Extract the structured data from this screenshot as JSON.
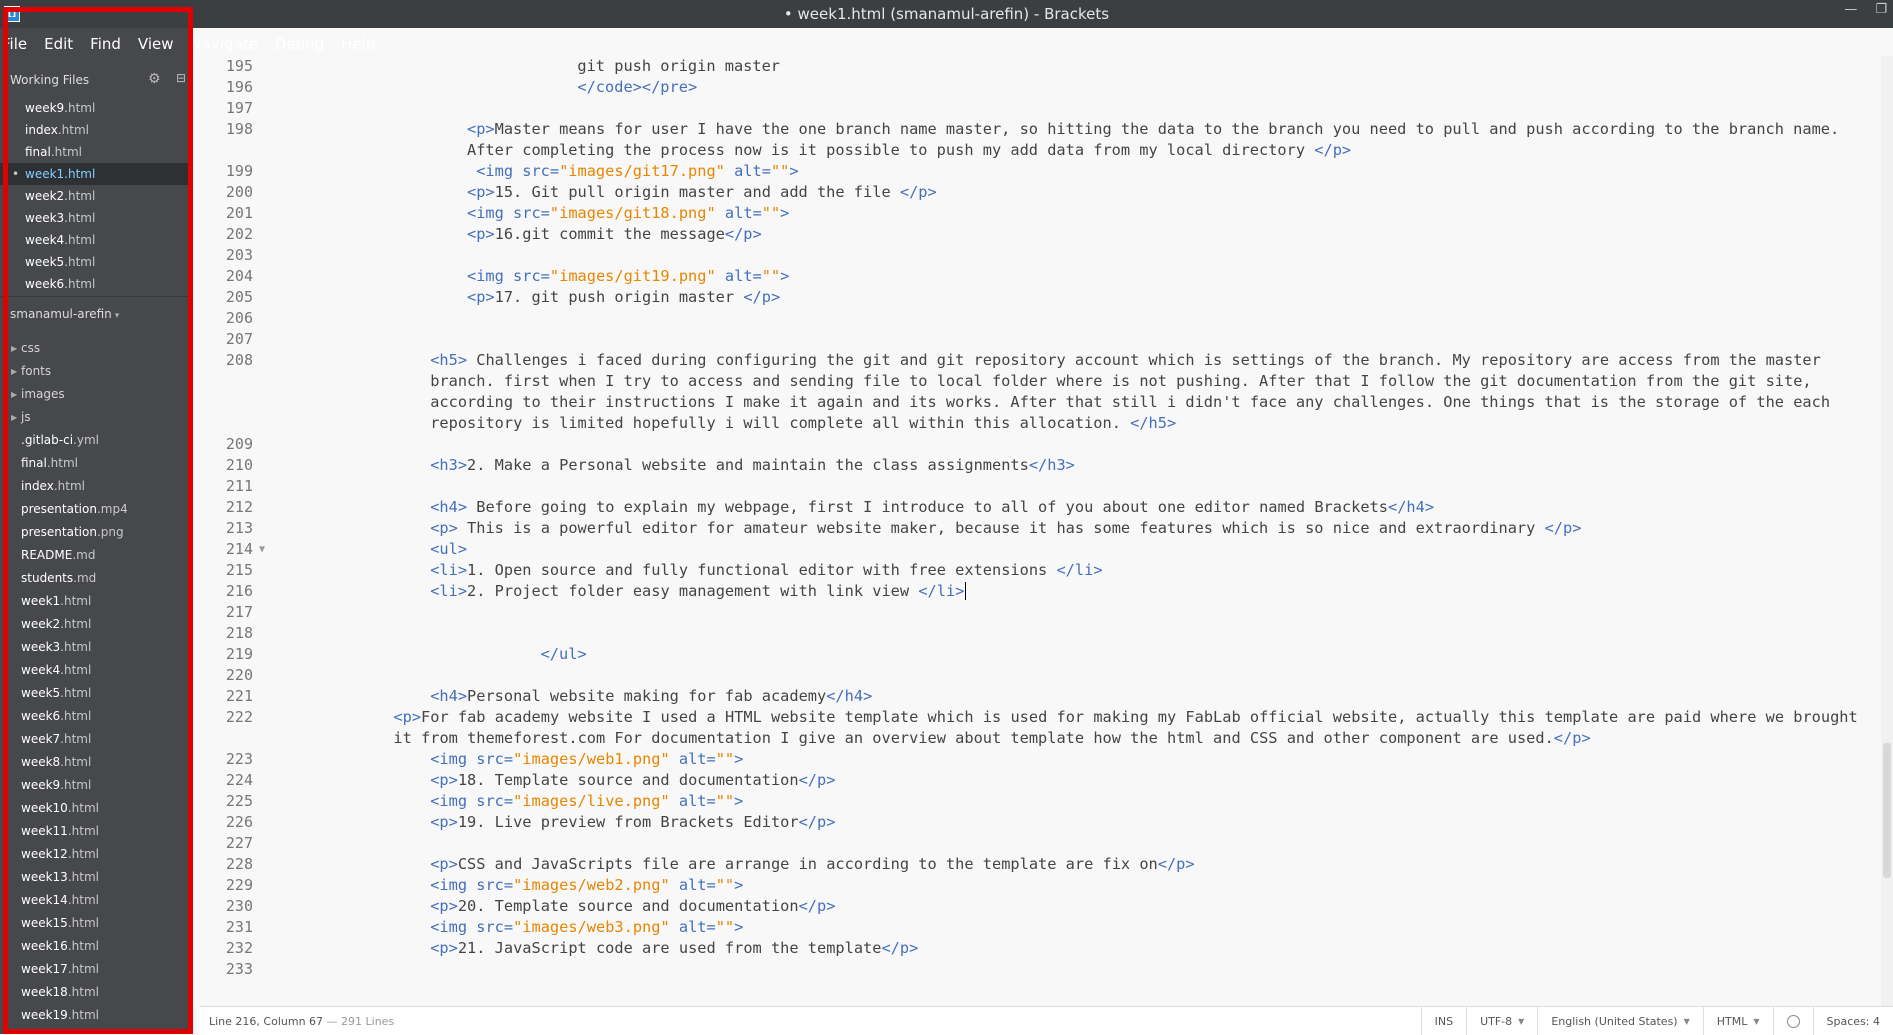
{
  "window": {
    "title": "• week1.html (smanamul-arefin) - Brackets",
    "icon": "brackets-app-icon",
    "controls": [
      "—",
      "❐"
    ]
  },
  "menu": [
    "File",
    "Edit",
    "Find",
    "View",
    "Navigate",
    "Debug",
    "Help"
  ],
  "sidebar": {
    "working_files_label": "Working Files",
    "working_files": [
      {
        "name": "week9",
        "ext": ".html",
        "active": false
      },
      {
        "name": "index",
        "ext": ".html",
        "active": false
      },
      {
        "name": "final",
        "ext": ".html",
        "active": false
      },
      {
        "name": "week1",
        "ext": ".html",
        "active": true
      },
      {
        "name": "week2",
        "ext": ".html",
        "active": false
      },
      {
        "name": "week3",
        "ext": ".html",
        "active": false
      },
      {
        "name": "week4",
        "ext": ".html",
        "active": false
      },
      {
        "name": "week5",
        "ext": ".html",
        "active": false
      },
      {
        "name": "week6",
        "ext": ".html",
        "active": false
      }
    ],
    "project_name": "smanamul-arefin",
    "tree": [
      {
        "name": "css",
        "ext": "",
        "folder": true
      },
      {
        "name": "fonts",
        "ext": "",
        "folder": true
      },
      {
        "name": "images",
        "ext": "",
        "folder": true
      },
      {
        "name": "js",
        "ext": "",
        "folder": true
      },
      {
        "name": ".gitlab-ci",
        "ext": ".yml",
        "folder": false
      },
      {
        "name": "final",
        "ext": ".html",
        "folder": false
      },
      {
        "name": "index",
        "ext": ".html",
        "folder": false
      },
      {
        "name": "presentation",
        "ext": ".mp4",
        "folder": false
      },
      {
        "name": "presentation",
        "ext": ".png",
        "folder": false
      },
      {
        "name": "README",
        "ext": ".md",
        "folder": false
      },
      {
        "name": "students",
        "ext": ".md",
        "folder": false
      },
      {
        "name": "week1",
        "ext": ".html",
        "folder": false
      },
      {
        "name": "week2",
        "ext": ".html",
        "folder": false
      },
      {
        "name": "week3",
        "ext": ".html",
        "folder": false
      },
      {
        "name": "week4",
        "ext": ".html",
        "folder": false
      },
      {
        "name": "week5",
        "ext": ".html",
        "folder": false
      },
      {
        "name": "week6",
        "ext": ".html",
        "folder": false
      },
      {
        "name": "week7",
        "ext": ".html",
        "folder": false
      },
      {
        "name": "week8",
        "ext": ".html",
        "folder": false
      },
      {
        "name": "week9",
        "ext": ".html",
        "folder": false
      },
      {
        "name": "week10",
        "ext": ".html",
        "folder": false
      },
      {
        "name": "week11",
        "ext": ".html",
        "folder": false
      },
      {
        "name": "week12",
        "ext": ".html",
        "folder": false
      },
      {
        "name": "week13",
        "ext": ".html",
        "folder": false
      },
      {
        "name": "week14",
        "ext": ".html",
        "folder": false
      },
      {
        "name": "week15",
        "ext": ".html",
        "folder": false
      },
      {
        "name": "week16",
        "ext": ".html",
        "folder": false
      },
      {
        "name": "week17",
        "ext": ".html",
        "folder": false
      },
      {
        "name": "week18",
        "ext": ".html",
        "folder": false
      },
      {
        "name": "week19",
        "ext": ".html",
        "folder": false
      }
    ]
  },
  "editor": {
    "lines": [
      {
        "n": "195",
        "indent": 32,
        "rows": 1,
        "text": "git push origin master"
      },
      {
        "n": "196",
        "indent": 32,
        "rows": 1,
        "text": "</code></pre>"
      },
      {
        "n": "197",
        "indent": 0,
        "rows": 1,
        "text": ""
      },
      {
        "n": "198",
        "indent": 20,
        "rows": 2,
        "text": "<p>Master means for user I have the one branch name master, so hitting the data to the branch you need to pull and push according to the branch name. After completing the process now is it possible to push my add data from my local directory </p>"
      },
      {
        "n": "199",
        "indent": 21,
        "rows": 1,
        "text": "<img src=\"images/git17.png\" alt=\"\">"
      },
      {
        "n": "200",
        "indent": 20,
        "rows": 1,
        "text": "<p>15. Git pull origin master and add the file </p>"
      },
      {
        "n": "201",
        "indent": 20,
        "rows": 1,
        "text": "<img src=\"images/git18.png\" alt=\"\">"
      },
      {
        "n": "202",
        "indent": 20,
        "rows": 1,
        "text": "<p>16.git commit the message</p>"
      },
      {
        "n": "203",
        "indent": 0,
        "rows": 1,
        "text": ""
      },
      {
        "n": "204",
        "indent": 20,
        "rows": 1,
        "text": "<img src=\"images/git19.png\" alt=\"\">"
      },
      {
        "n": "205",
        "indent": 20,
        "rows": 1,
        "text": "<p>17. git push origin master </p>"
      },
      {
        "n": "206",
        "indent": 0,
        "rows": 1,
        "text": ""
      },
      {
        "n": "207",
        "indent": 0,
        "rows": 1,
        "text": ""
      },
      {
        "n": "208",
        "indent": 16,
        "rows": 4,
        "text": "<h5> Challenges i faced during configuring the git and git repository account which is settings of the branch. My repository are access from the master branch. first when I try to access and sending file to local folder where is not pushing. After that I follow the git documentation from the git site, according to their instructions I make it again and its works. After that still i didn't face any challenges. One things that is the storage of the each repository is limited hopefully i will complete all within this allocation. </h5>"
      },
      {
        "n": "209",
        "indent": 0,
        "rows": 1,
        "text": ""
      },
      {
        "n": "210",
        "indent": 16,
        "rows": 1,
        "text": "<h3>2. Make a Personal website and maintain the class assignments</h3>"
      },
      {
        "n": "211",
        "indent": 0,
        "rows": 1,
        "text": ""
      },
      {
        "n": "212",
        "indent": 16,
        "rows": 1,
        "text": "<h4> Before going to explain my webpage, first I introduce to all of you about one editor named Brackets</h4>"
      },
      {
        "n": "213",
        "indent": 16,
        "rows": 1,
        "text": "<p> This is a powerful editor for amateur website maker, because it has some features which is so nice and extraordinary </p>"
      },
      {
        "n": "214",
        "indent": 16,
        "rows": 1,
        "text": "<ul>",
        "fold": true
      },
      {
        "n": "215",
        "indent": 16,
        "rows": 1,
        "text": "<li>1. Open source and fully functional editor with free extensions </li>"
      },
      {
        "n": "216",
        "indent": 16,
        "rows": 1,
        "text": "<li>2. Project folder easy management with link view </li>",
        "cursor": true
      },
      {
        "n": "217",
        "indent": 0,
        "rows": 1,
        "text": ""
      },
      {
        "n": "218",
        "indent": 0,
        "rows": 1,
        "text": ""
      },
      {
        "n": "219",
        "indent": 28,
        "rows": 1,
        "text": "</ul>"
      },
      {
        "n": "220",
        "indent": 0,
        "rows": 1,
        "text": ""
      },
      {
        "n": "221",
        "indent": 16,
        "rows": 1,
        "text": "<h4>Personal website making for fab academy</h4>"
      },
      {
        "n": "222",
        "indent": 12,
        "rows": 2,
        "text": "<p>For fab academy website I used a HTML website template which is used for making my FabLab official website, actually this template are paid where we brought it from themeforest.com For documentation I give an overview about template how the html and CSS and other component are used.</p>"
      },
      {
        "n": "223",
        "indent": 16,
        "rows": 1,
        "text": "<img src=\"images/web1.png\" alt=\"\">"
      },
      {
        "n": "224",
        "indent": 16,
        "rows": 1,
        "text": "<p>18. Template source and documentation</p>"
      },
      {
        "n": "225",
        "indent": 16,
        "rows": 1,
        "text": "<img src=\"images/live.png\" alt=\"\">"
      },
      {
        "n": "226",
        "indent": 16,
        "rows": 1,
        "text": "<p>19. Live preview from Brackets Editor</p>"
      },
      {
        "n": "227",
        "indent": 0,
        "rows": 1,
        "text": ""
      },
      {
        "n": "228",
        "indent": 16,
        "rows": 1,
        "text": "<p>CSS and JavaScripts file are arrange in according to the template are fix on</p>"
      },
      {
        "n": "229",
        "indent": 16,
        "rows": 1,
        "text": "<img src=\"images/web2.png\" alt=\"\">"
      },
      {
        "n": "230",
        "indent": 16,
        "rows": 1,
        "text": "<p>20. Template source and documentation</p>"
      },
      {
        "n": "231",
        "indent": 16,
        "rows": 1,
        "text": "<img src=\"images/web3.png\" alt=\"\">"
      },
      {
        "n": "232",
        "indent": 16,
        "rows": 1,
        "text": "<p>21. JavaScript code are used from the template</p>"
      },
      {
        "n": "233",
        "indent": 0,
        "rows": 1,
        "text": ""
      }
    ]
  },
  "status": {
    "cursor_position": "Line 216, Column 67",
    "line_count": " — 291 Lines",
    "mode": "INS",
    "encoding": "UTF-8",
    "spellcheck_lang": "English (United States)",
    "language": "HTML",
    "spaces": "Spaces: 4"
  },
  "colors": {
    "sidebar_bg": "#47484b",
    "active_file": "#7fd0ff",
    "tag": "#446fbd",
    "string": "#e88501",
    "highlight": "#e00000"
  }
}
